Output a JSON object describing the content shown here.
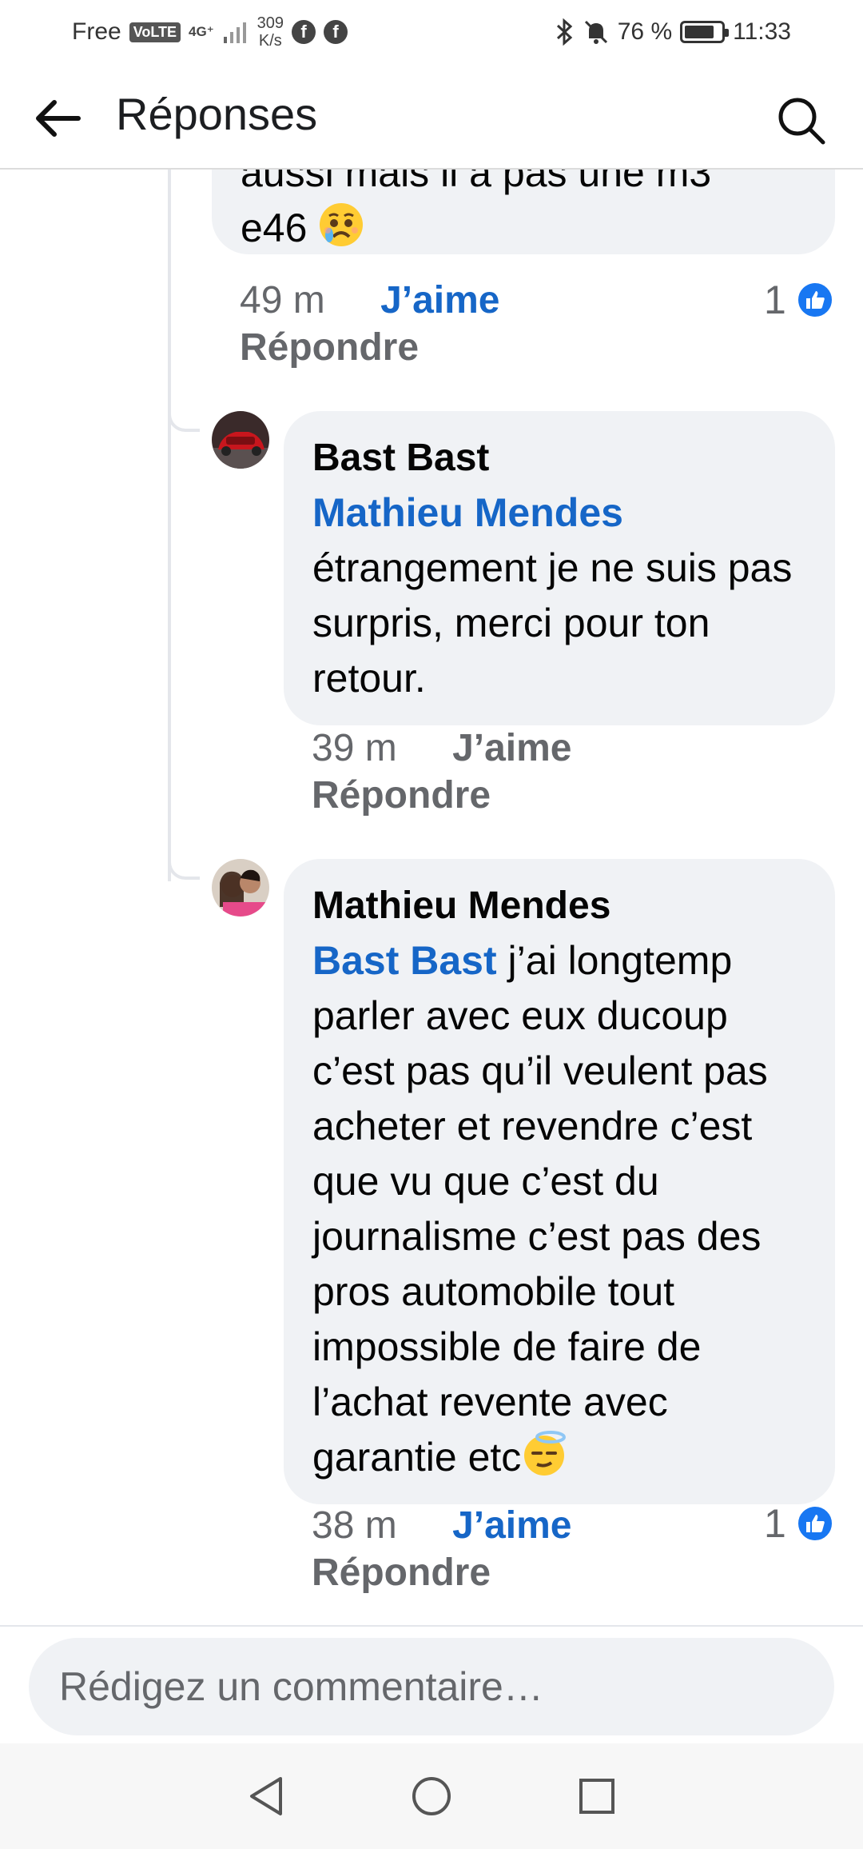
{
  "status_bar": {
    "carrier": "Free",
    "volte": "VoLTE",
    "network": "4G⁺",
    "speed_value": "309",
    "speed_unit": "K/s",
    "battery_percent": "76 %",
    "time": "11:33",
    "battery_level": 0.76
  },
  "header": {
    "title": "Réponses"
  },
  "comments": [
    {
      "text_line1": "aussi mais il a pas une m3",
      "text_line2": "e46",
      "emoji": "crying-face-emoji",
      "time": "49 m",
      "like_label": "J’aime",
      "like_active": true,
      "reply_label": "Répondre",
      "reaction_count": "1"
    },
    {
      "author": "Bast Bast",
      "mention": "Mathieu Mendes",
      "text": "étrangement je ne suis pas surpris, merci pour ton retour.",
      "time": "39 m",
      "like_label": "J’aime",
      "like_active": false,
      "reply_label": "Répondre"
    },
    {
      "author": "Mathieu Mendes",
      "mention": "Bast Bast",
      "text": "j’ai longtemp parler avec eux ducoup c’est pas qu’il veulent pas acheter et revendre c’est que vu que c’est du journalisme c’est pas des pros automobile tout impossible de faire de l’achat revente avec garantie etc",
      "emoji": "face-with-halo-emoji",
      "time": "38 m",
      "like_label": "J’aime",
      "like_active": true,
      "reply_label": "Répondre",
      "reaction_count": "1"
    }
  ],
  "composer": {
    "placeholder": "Rédigez un commentaire…"
  },
  "colors": {
    "accent": "#1666c7",
    "bubble": "#f0f2f5",
    "muted": "#65676b",
    "like_badge": "#1877f2"
  }
}
